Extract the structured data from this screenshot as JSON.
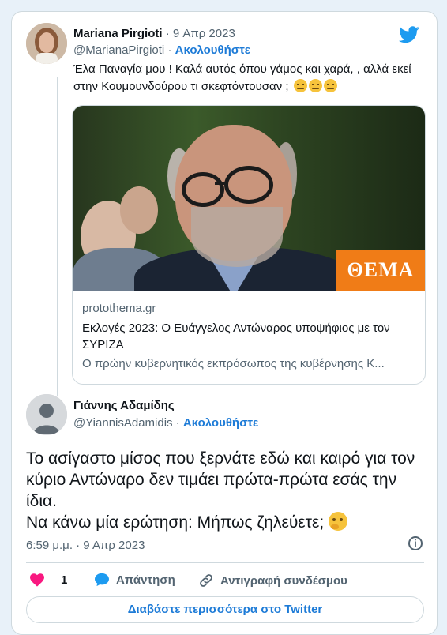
{
  "tweet1": {
    "name": "Mariana Pirgioti",
    "date": "· 9 Απρ 2023",
    "handle": "@MarianaPirgioti",
    "follow_sep": "·",
    "follow": "Ακολουθήστε",
    "text": "Έλα Παναγία μου ! Καλά αυτός όπου γάμος και χαρά, , αλλά εκεί στην Κουμουνδούρου τι σκεφτόντουσαν ;",
    "emoji_icon": "grimacing-face-icon"
  },
  "link_preview": {
    "logo": "ΘΕΜΑ",
    "domain": "protothema.gr",
    "title": "Εκλογές 2023: Ο Ευάγγελος Αντώναρος υποψήφιος με τον ΣΥΡΙΖΑ",
    "description": "Ο πρώην κυβερνητικός εκπρόσωπος της κυβέρνησης Κ..."
  },
  "tweet2": {
    "name": "Γιάννης Αδαμίδης",
    "handle": "@YiannisAdamidis",
    "follow_sep": "·",
    "follow": "Ακολουθήστε",
    "text_line1": "Το ασίγαστο μίσος που ξερνάτε εδώ και καιρό για τον κύριο Αντώναρο δεν τιμάει πρώτα-πρώτα εσάς την ίδια.",
    "text_line2": "Να κάνω μία ερώτηση: Μήπως ζηλεύετε;",
    "emoji_icon": "thinking-face-icon",
    "timestamp": "6:59 μ.μ. · 9 Απρ 2023"
  },
  "actions": {
    "likes": "1",
    "reply": "Απάντηση",
    "copy_link": "Αντιγραφή συνδέσμου"
  },
  "read_more": "Διαβάστε περισσότερα στο Twitter",
  "colors": {
    "accent": "#1d7bd7",
    "heart": "#f91880",
    "reply": "#1d9bf0",
    "theme_logo": "#f07c17"
  }
}
